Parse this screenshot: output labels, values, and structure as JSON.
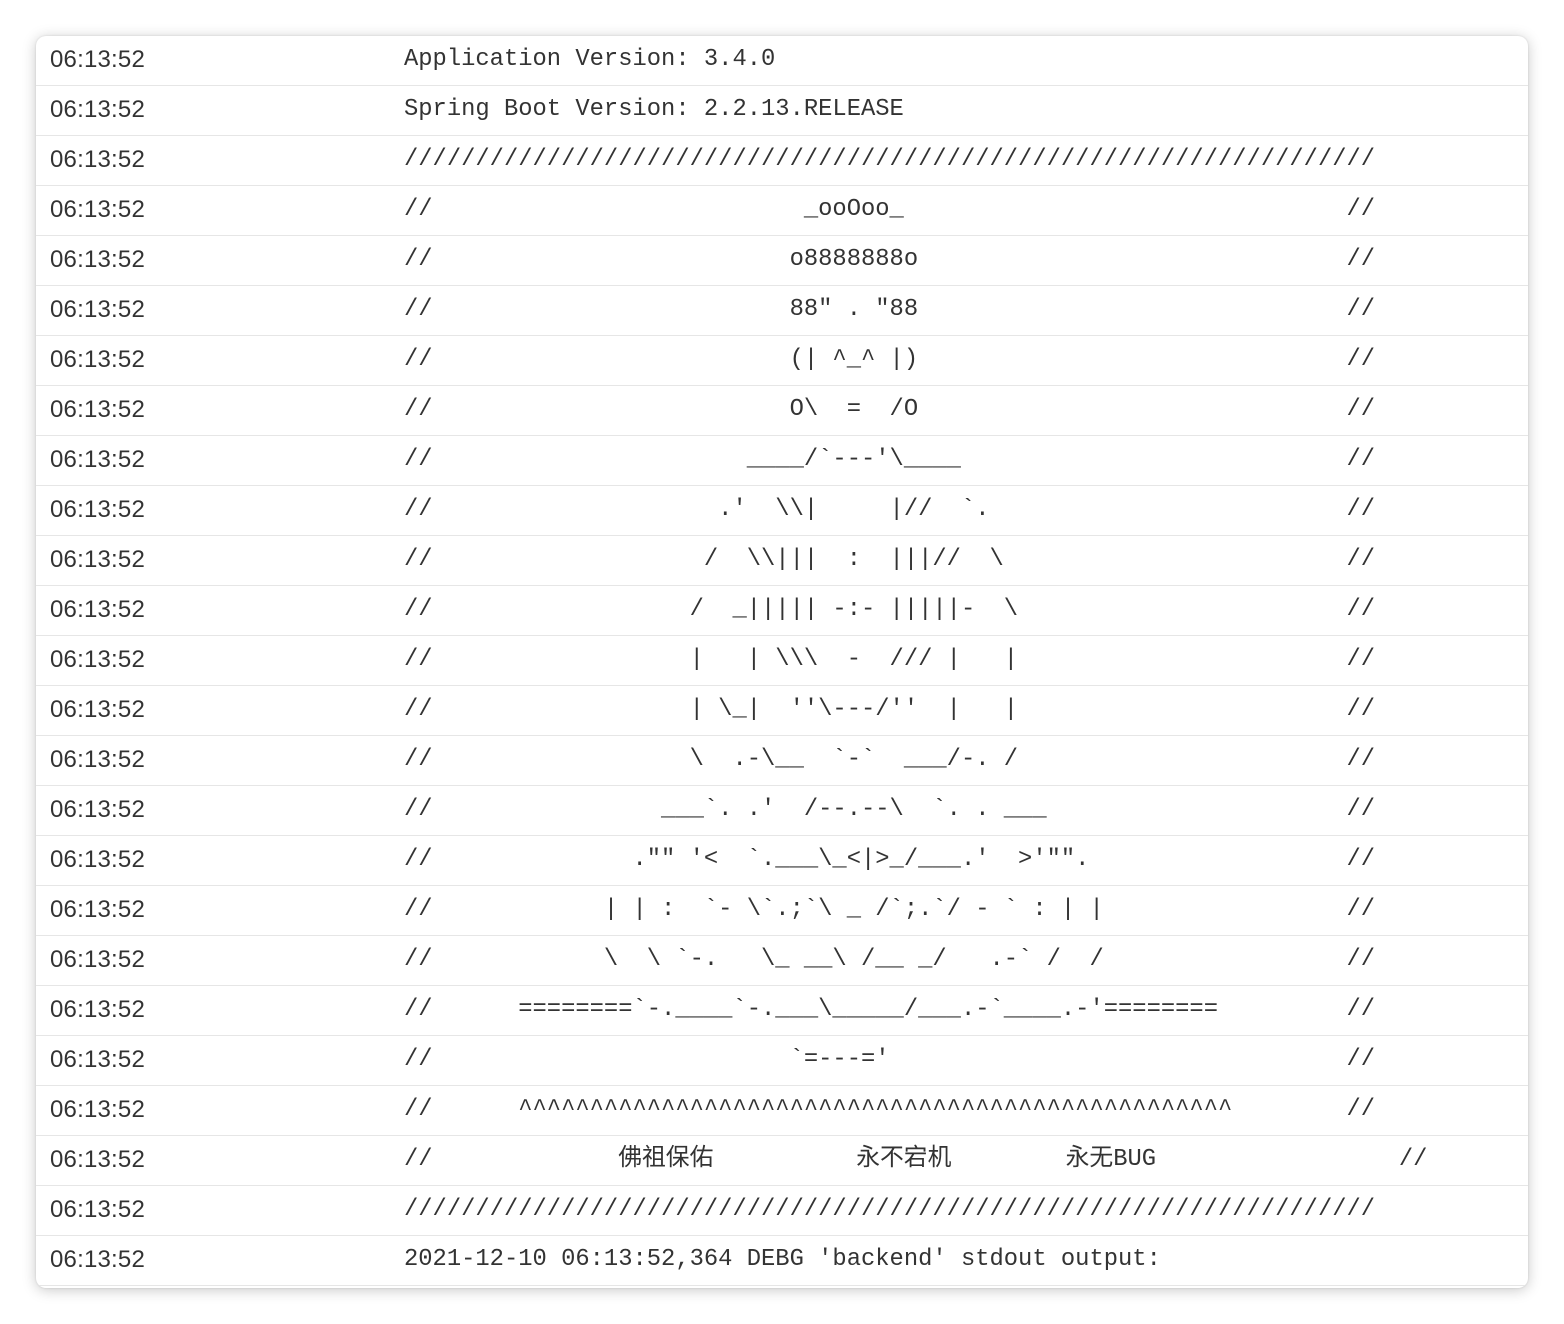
{
  "log": {
    "rows": [
      {
        "time": "06:13:52",
        "message": "Application Version: 3.4.0"
      },
      {
        "time": "06:13:52",
        "message": "Spring Boot Version: 2.2.13.RELEASE"
      },
      {
        "time": "06:13:52",
        "message": "////////////////////////////////////////////////////////////////////"
      },
      {
        "time": "06:13:52",
        "message": "//                          _ooOoo_                               //"
      },
      {
        "time": "06:13:52",
        "message": "//                         o8888888o                              //"
      },
      {
        "time": "06:13:52",
        "message": "//                         88\" . \"88                              //"
      },
      {
        "time": "06:13:52",
        "message": "//                         (| ^_^ |)                              //"
      },
      {
        "time": "06:13:52",
        "message": "//                         O\\  =  /O                              //"
      },
      {
        "time": "06:13:52",
        "message": "//                      ____/`---'\\____                           //"
      },
      {
        "time": "06:13:52",
        "message": "//                    .'  \\\\|     |//  `.                         //"
      },
      {
        "time": "06:13:52",
        "message": "//                   /  \\\\|||  :  |||//  \\                        //"
      },
      {
        "time": "06:13:52",
        "message": "//                  /  _||||| -:- |||||-  \\                       //"
      },
      {
        "time": "06:13:52",
        "message": "//                  |   | \\\\\\  -  /// |   |                       //"
      },
      {
        "time": "06:13:52",
        "message": "//                  | \\_|  ''\\---/''  |   |                       //"
      },
      {
        "time": "06:13:52",
        "message": "//                  \\  .-\\__  `-`  ___/-. /                       //"
      },
      {
        "time": "06:13:52",
        "message": "//                ___`. .'  /--.--\\  `. . ___                     //"
      },
      {
        "time": "06:13:52",
        "message": "//              .\"\" '<  `.___\\_<|>_/___.'  >'\"\".                  //"
      },
      {
        "time": "06:13:52",
        "message": "//            | | :  `- \\`.;`\\ _ /`;.`/ - ` : | |                 //"
      },
      {
        "time": "06:13:52",
        "message": "//            \\  \\ `-.   \\_ __\\ /__ _/   .-` /  /                 //"
      },
      {
        "time": "06:13:52",
        "message": "//      ========`-.____`-.___\\_____/___.-`____.-'========         //"
      },
      {
        "time": "06:13:52",
        "message": "//                         `=---='                                //"
      },
      {
        "time": "06:13:52",
        "message": "//      ^^^^^^^^^^^^^^^^^^^^^^^^^^^^^^^^^^^^^^^^^^^^^^^^^^        //"
      },
      {
        "time": "06:13:52",
        "message": "//             佛祖保佑          永不宕机        永无BUG                 //"
      },
      {
        "time": "06:13:52",
        "message": "////////////////////////////////////////////////////////////////////"
      },
      {
        "time": "06:13:52",
        "message": "2021-12-10 06:13:52,364 DEBG 'backend' stdout output:"
      }
    ]
  }
}
